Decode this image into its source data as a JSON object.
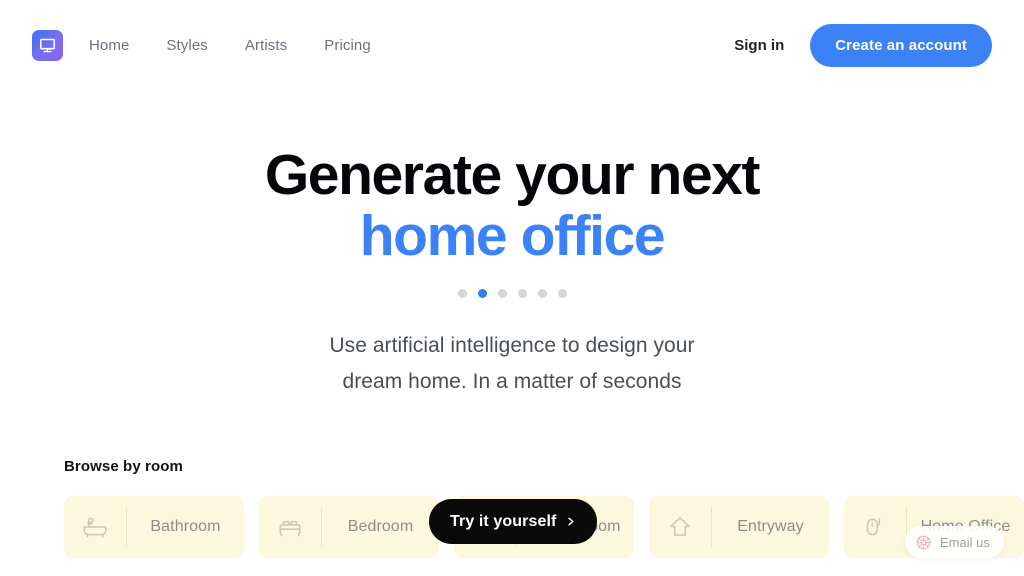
{
  "brand": {
    "logo_icon": "monitor-icon",
    "gradient_from": "#3b6ef6",
    "gradient_to": "#8c63ee"
  },
  "nav": {
    "links": [
      {
        "label": "Home"
      },
      {
        "label": "Styles"
      },
      {
        "label": "Artists"
      },
      {
        "label": "Pricing"
      }
    ],
    "signin_label": "Sign in",
    "cta_label": "Create an account",
    "cta_color": "#3b82f6"
  },
  "hero": {
    "title_line1": "Generate your next",
    "title_line2": "home office",
    "accent_color": "#3b82f6",
    "subtitle_line1": "Use artificial intelligence to design your",
    "subtitle_line2": "dream home. In a matter of seconds",
    "carousel": {
      "total": 6,
      "active_index": 1,
      "active_color": "#2f7ef5",
      "inactive_color": "#d3d6dc"
    }
  },
  "browse": {
    "heading": "Browse by room",
    "card_bg": "#fcf8dd",
    "cards": [
      {
        "label": "Bathroom",
        "icon": "bathtub-icon"
      },
      {
        "label": "Bedroom",
        "icon": "bed-icon"
      },
      {
        "label": "Living Room",
        "icon": "sofa-icon"
      },
      {
        "label": "Entryway",
        "icon": "entry-arrow-icon"
      },
      {
        "label": "Home Office",
        "icon": "mouse-icon"
      }
    ]
  },
  "try_button": {
    "label": "Try it yourself",
    "icon": "chevron-right-icon",
    "bg": "#0a0a0a"
  },
  "email_widget": {
    "label": "Email us",
    "icon": "flower-icon",
    "icon_color": "#f6a8b8"
  }
}
